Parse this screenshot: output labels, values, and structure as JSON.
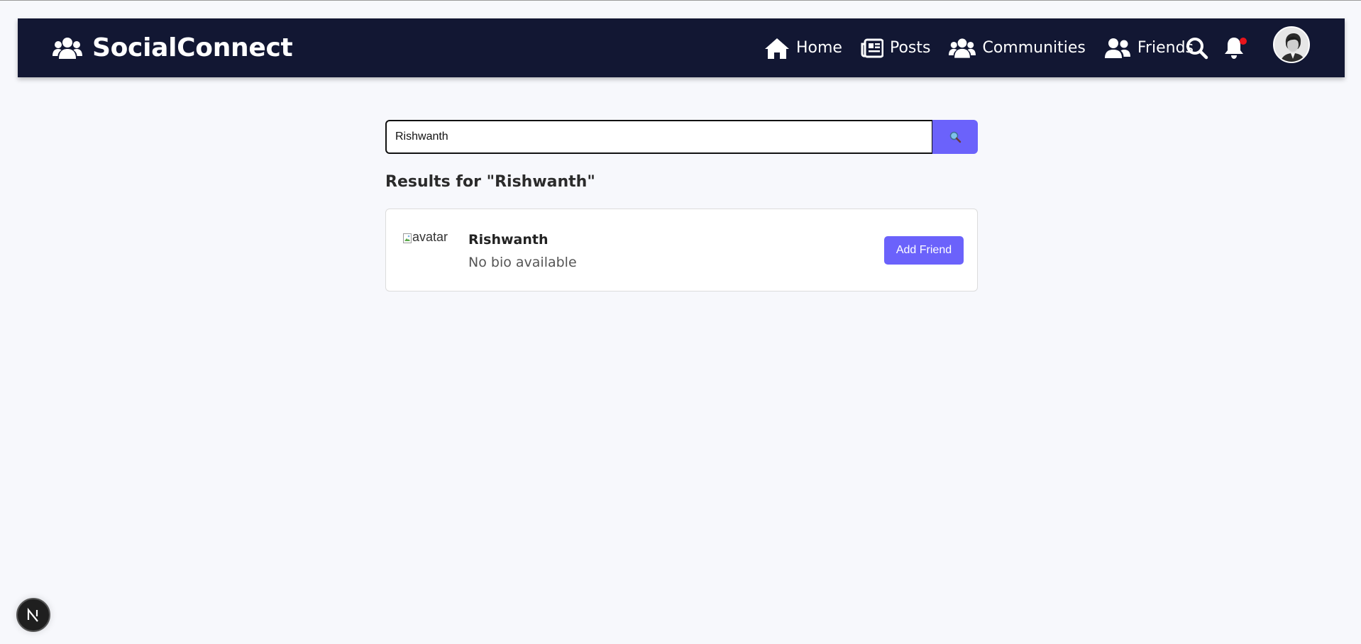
{
  "brand": {
    "name": "SocialConnect",
    "icon": "users-icon"
  },
  "nav": {
    "items": [
      {
        "label": "Home",
        "icon": "home-icon"
      },
      {
        "label": "Posts",
        "icon": "newspaper-icon"
      },
      {
        "label": "Communities",
        "icon": "users-icon"
      },
      {
        "label": "Friends",
        "icon": "user-friends-icon"
      }
    ],
    "search_icon": "search-icon",
    "notification_icon": "bell-icon",
    "has_unread_notifications": true
  },
  "search": {
    "value": "Rishwanth",
    "button_icon": "magnifier-icon"
  },
  "results": {
    "heading": "Results for \"Rishwanth\"",
    "items": [
      {
        "avatar_alt": "avatar",
        "name": "Rishwanth",
        "bio": "No bio available",
        "action_label": "Add Friend"
      }
    ]
  },
  "dev_badge": {
    "label": "N"
  },
  "colors": {
    "navbar": "#121733",
    "accent": "#6b62fb",
    "background": "#f7f8fc",
    "notification_dot": "#e8141b"
  }
}
